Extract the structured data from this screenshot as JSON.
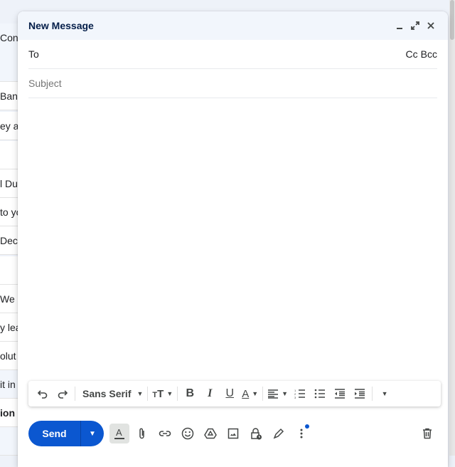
{
  "background_list": {
    "rows": [
      {
        "text": "Conf",
        "state": "grey"
      },
      {
        "text": "Ban",
        "state": "normal"
      },
      {
        "text": "ey a",
        "state": "normal"
      },
      {
        "text": "",
        "state": "normal"
      },
      {
        "text": "l Du",
        "state": "normal"
      },
      {
        "text": "to yo",
        "state": "normal"
      },
      {
        "text": " Dec",
        "state": "normal"
      },
      {
        "text": "",
        "state": "normal"
      },
      {
        "text": "We h",
        "state": "normal"
      },
      {
        "text": "y lea",
        "state": "normal"
      },
      {
        "text": "olut",
        "state": "normal"
      },
      {
        "text": "it in",
        "state": "selected"
      },
      {
        "text": "ion -",
        "state": "bold"
      },
      {
        "text": "",
        "state": "grey"
      }
    ]
  },
  "compose": {
    "title": "New Message",
    "header_icons": [
      "minimize-icon",
      "fullscreen-icon",
      "close-icon"
    ],
    "to_label": "To",
    "to_value": "",
    "cc_label": "Cc",
    "bcc_label": "Bcc",
    "subject_placeholder": "Subject",
    "subject_value": "",
    "body": "",
    "formatting": {
      "font": "Sans Serif",
      "buttons": [
        "undo",
        "redo",
        "font",
        "text-size",
        "bold",
        "italic",
        "underline",
        "text-color",
        "align",
        "numbered-list",
        "bulleted-list",
        "indent-less",
        "indent-more",
        "more-formatting"
      ]
    },
    "send_label": "Send",
    "bottom_icons": [
      "formatting-options-icon",
      "attach-icon",
      "link-icon",
      "emoji-icon",
      "drive-icon",
      "photo-icon",
      "confidential-icon",
      "signature-icon",
      "more-options-icon",
      "discard-icon"
    ]
  }
}
